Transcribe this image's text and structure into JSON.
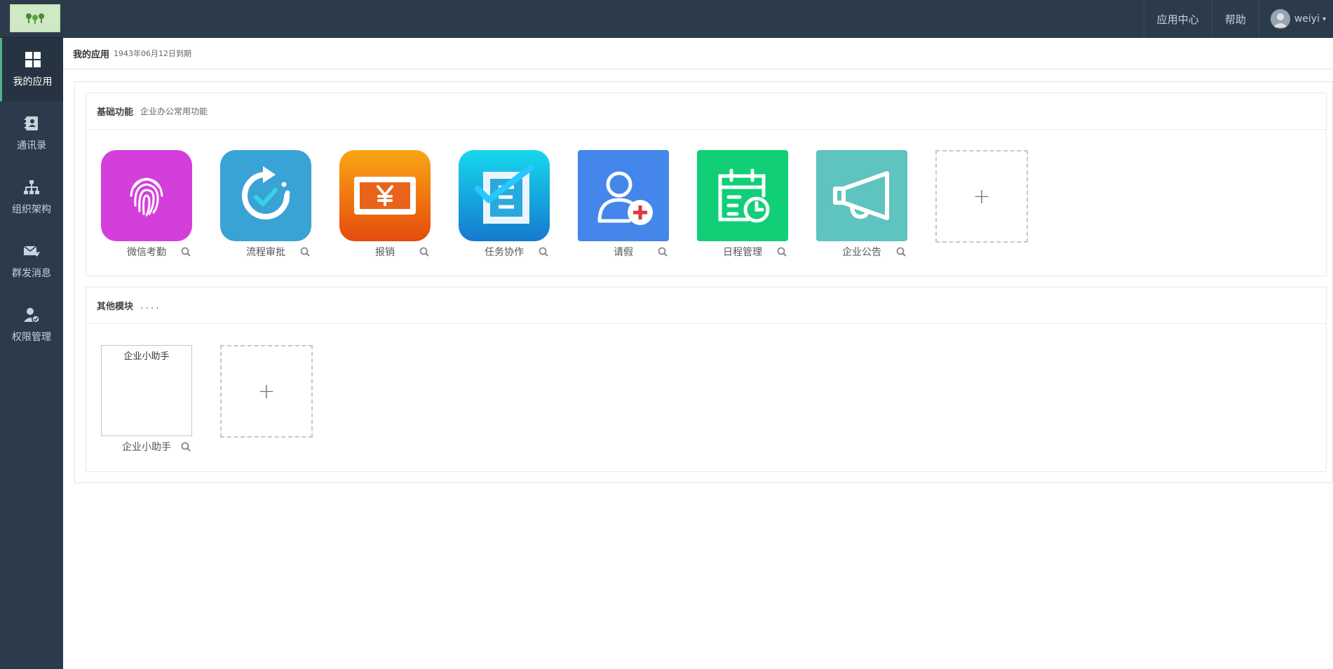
{
  "topbar": {
    "nav": [
      "应用中心",
      "帮助"
    ],
    "username": "weiyi"
  },
  "sidebar": {
    "items": [
      {
        "label": "我的应用",
        "icon": "grid-icon",
        "active": true
      },
      {
        "label": "通讯录",
        "icon": "contacts-icon",
        "active": false
      },
      {
        "label": "组织架构",
        "icon": "org-chart-icon",
        "active": false
      },
      {
        "label": "群发消息",
        "icon": "message-icon",
        "active": false
      },
      {
        "label": "权限管理",
        "icon": "user-permission-icon",
        "active": false
      }
    ]
  },
  "breadcrumb": {
    "title": "我的应用",
    "expiry": "1943年06月12日到期"
  },
  "basic": {
    "title": "基础功能",
    "subtitle": "企业办公常用功能",
    "apps": [
      {
        "label": "微信考勤",
        "icon": "fingerprint-icon",
        "color": "#d43fdc"
      },
      {
        "label": "流程审批",
        "icon": "process-approval-icon",
        "color": "#3aa3d6"
      },
      {
        "label": "报销",
        "icon": "reimbursement-icon",
        "color": "#f07a1b"
      },
      {
        "label": "任务协作",
        "icon": "task-checklist-icon",
        "color": "#1f9ad9"
      },
      {
        "label": "请假",
        "icon": "leave-user-icon",
        "color": "#4486ea"
      },
      {
        "label": "日程管理",
        "icon": "calendar-clock-icon",
        "color": "#10cf76"
      },
      {
        "label": "企业公告",
        "icon": "megaphone-icon",
        "color": "#5fc3bf"
      }
    ],
    "add_symbol": "+"
  },
  "other": {
    "title": "其他模块",
    "dots": "....",
    "apps": [
      {
        "label": "企业小助手",
        "image_alt": "企业小助手"
      }
    ],
    "add_symbol": "+"
  },
  "colors": {
    "topbar": "#2c3b4c",
    "accent": "#4fb48a"
  }
}
